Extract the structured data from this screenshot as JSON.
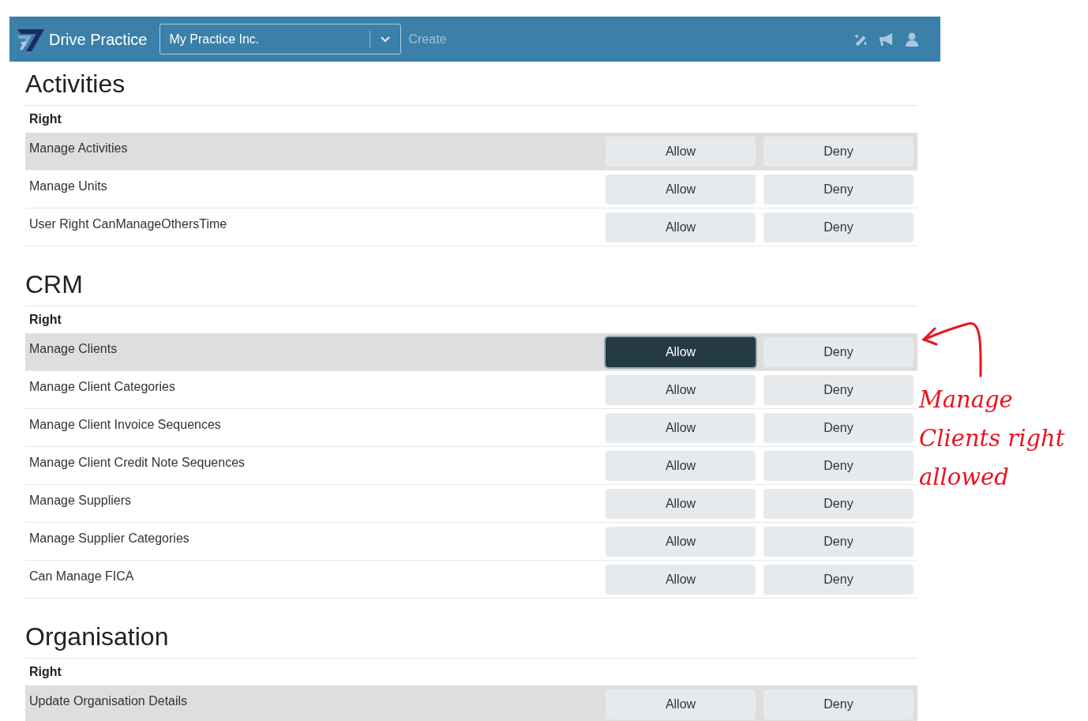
{
  "header": {
    "brand": "Drive Practice",
    "company_select": {
      "value": "My Practice Inc."
    },
    "create_link": "Create"
  },
  "sections": [
    {
      "title": "Activities",
      "column_header": "Right",
      "rows": [
        {
          "label": "Manage Activities",
          "highlighted": true,
          "allow": "Allow",
          "deny": "Deny",
          "allow_selected": false,
          "deny_selected": false
        },
        {
          "label": "Manage Units",
          "highlighted": false,
          "allow": "Allow",
          "deny": "Deny",
          "allow_selected": false,
          "deny_selected": false
        },
        {
          "label": "User Right CanManageOthersTime",
          "highlighted": false,
          "allow": "Allow",
          "deny": "Deny",
          "allow_selected": false,
          "deny_selected": false
        }
      ]
    },
    {
      "title": "CRM",
      "column_header": "Right",
      "rows": [
        {
          "label": "Manage Clients",
          "highlighted": true,
          "allow": "Allow",
          "deny": "Deny",
          "allow_selected": true,
          "deny_selected": false
        },
        {
          "label": "Manage Client Categories",
          "highlighted": false,
          "allow": "Allow",
          "deny": "Deny",
          "allow_selected": false,
          "deny_selected": false
        },
        {
          "label": "Manage Client Invoice Sequences",
          "highlighted": false,
          "allow": "Allow",
          "deny": "Deny",
          "allow_selected": false,
          "deny_selected": false
        },
        {
          "label": "Manage Client Credit Note Sequences",
          "highlighted": false,
          "allow": "Allow",
          "deny": "Deny",
          "allow_selected": false,
          "deny_selected": false
        },
        {
          "label": "Manage Suppliers",
          "highlighted": false,
          "allow": "Allow",
          "deny": "Deny",
          "allow_selected": false,
          "deny_selected": false
        },
        {
          "label": "Manage Supplier Categories",
          "highlighted": false,
          "allow": "Allow",
          "deny": "Deny",
          "allow_selected": false,
          "deny_selected": false
        },
        {
          "label": "Can Manage FICA",
          "highlighted": false,
          "allow": "Allow",
          "deny": "Deny",
          "allow_selected": false,
          "deny_selected": false
        }
      ]
    },
    {
      "title": "Organisation",
      "column_header": "Right",
      "rows": [
        {
          "label": "Update Organisation Details",
          "highlighted": true,
          "allow": "Allow",
          "deny": "Deny",
          "allow_selected": false,
          "deny_selected": false
        }
      ]
    }
  ],
  "annotation": {
    "text": "Manage Clients right allowed",
    "color": "#e8141e"
  }
}
